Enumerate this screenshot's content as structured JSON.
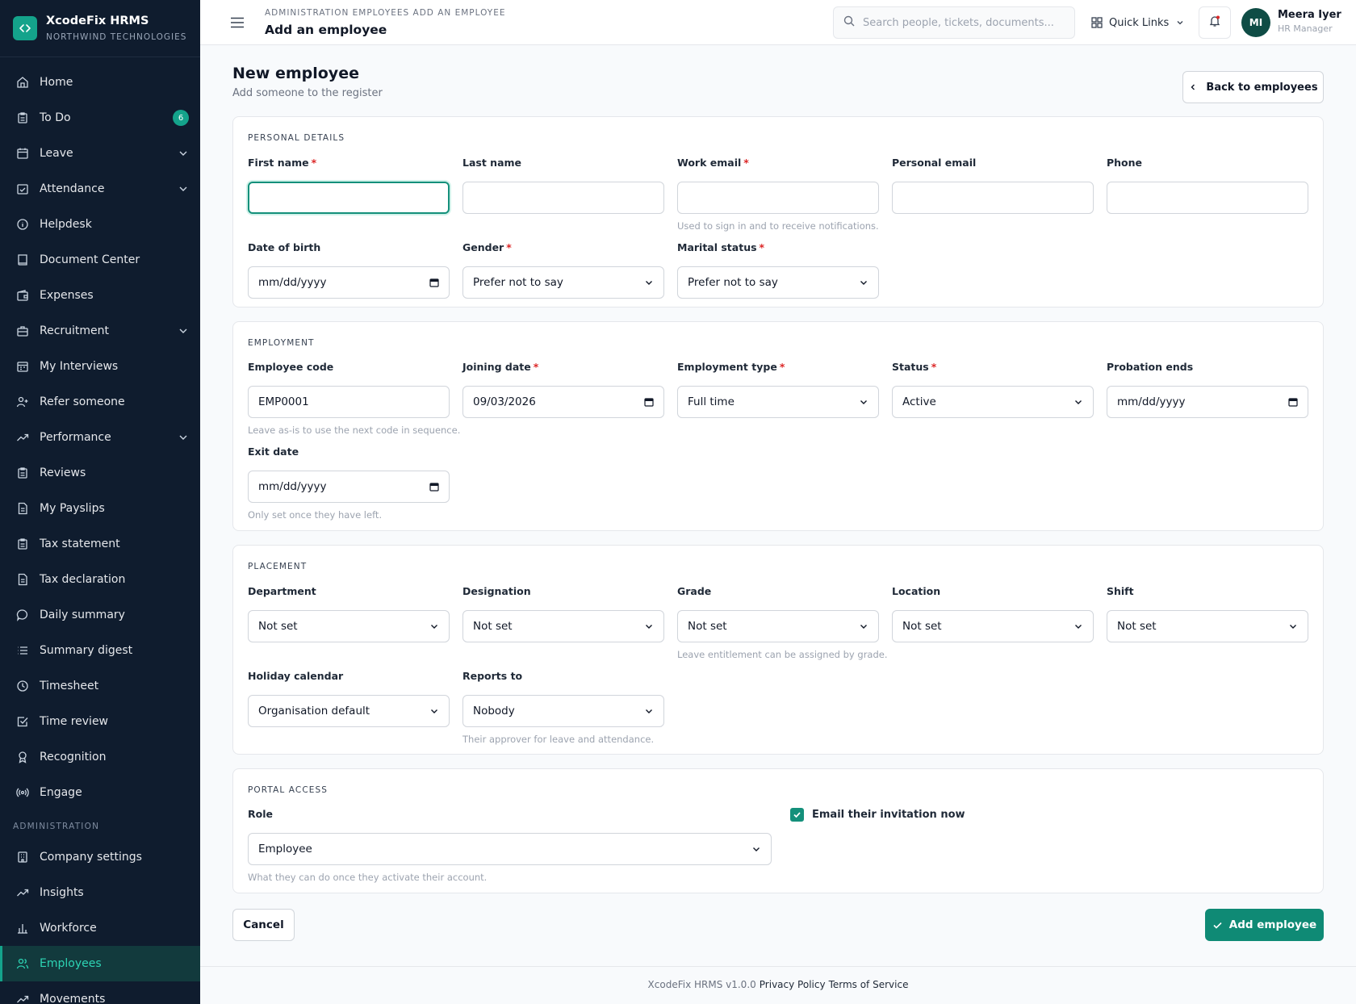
{
  "brand": {
    "title": "XcodeFix HRMS",
    "subtitle": "NORTHWIND TECHNOLOGIES"
  },
  "sidebar": {
    "items": [
      {
        "label": "Home",
        "icon": "home-icon"
      },
      {
        "label": "To Do",
        "icon": "clipboard-icon",
        "badge": "6"
      },
      {
        "label": "Leave",
        "icon": "calendar-icon",
        "chevron": true
      },
      {
        "label": "Attendance",
        "icon": "calendar-check-icon",
        "chevron": true
      },
      {
        "label": "Helpdesk",
        "icon": "info-circle-icon"
      },
      {
        "label": "Document Center",
        "icon": "book-icon"
      },
      {
        "label": "Expenses",
        "icon": "wallet-icon"
      },
      {
        "label": "Recruitment",
        "icon": "briefcase-icon",
        "chevron": true
      },
      {
        "label": "My Interviews",
        "icon": "calendar-icon"
      },
      {
        "label": "Refer someone",
        "icon": "user-plus-icon"
      },
      {
        "label": "Performance",
        "icon": "trending-up-icon",
        "chevron": true
      },
      {
        "label": "Reviews",
        "icon": "clipboard-icon"
      },
      {
        "label": "My Payslips",
        "icon": "file-icon"
      },
      {
        "label": "Tax statement",
        "icon": "clipboard-icon"
      },
      {
        "label": "Tax declaration",
        "icon": "file-icon"
      },
      {
        "label": "Daily summary",
        "icon": "message-icon"
      },
      {
        "label": "Summary digest",
        "icon": "list-icon"
      },
      {
        "label": "Timesheet",
        "icon": "clock-icon"
      },
      {
        "label": "Time review",
        "icon": "check-square-icon"
      },
      {
        "label": "Recognition",
        "icon": "award-icon"
      },
      {
        "label": "Engage",
        "icon": "broadcast-icon"
      }
    ],
    "section_admin": "ADMINISTRATION",
    "admin_items": [
      {
        "label": "Company settings",
        "icon": "building-icon"
      },
      {
        "label": "Insights",
        "icon": "trending-up-icon"
      },
      {
        "label": "Workforce",
        "icon": "bar-chart-icon"
      },
      {
        "label": "Employees",
        "icon": "users-icon",
        "active": true
      },
      {
        "label": "Movements",
        "icon": "trending-up-icon"
      }
    ]
  },
  "header": {
    "breadcrumb": "ADMINISTRATION  EMPLOYEES  ADD AN EMPLOYEE",
    "title": "Add an employee",
    "search_placeholder": "Search people, tickets, documents...",
    "quick_links": "Quick Links",
    "user": {
      "initials": "MI",
      "name": "Meera Iyer",
      "role": "HR Manager"
    }
  },
  "page": {
    "title": "New employee",
    "subtitle": "Add someone to the register",
    "back_label": "Back to employees"
  },
  "personal": {
    "section": "PERSONAL DETAILS",
    "first_name": {
      "label": "First name",
      "value": ""
    },
    "last_name": {
      "label": "Last name",
      "value": ""
    },
    "work_email": {
      "label": "Work email",
      "value": "",
      "hint": "Used to sign in and to receive notifications."
    },
    "personal_email": {
      "label": "Personal email",
      "value": ""
    },
    "phone": {
      "label": "Phone",
      "value": ""
    },
    "dob": {
      "label": "Date of birth",
      "value": "mm/dd/yyyy"
    },
    "gender": {
      "label": "Gender",
      "value": "Prefer not to say"
    },
    "marital": {
      "label": "Marital status",
      "value": "Prefer not to say"
    }
  },
  "employment": {
    "section": "EMPLOYMENT",
    "code": {
      "label": "Employee code",
      "value": "EMP0001",
      "hint": "Leave as-is to use the next code in sequence."
    },
    "joining": {
      "label": "Joining date",
      "value": "09/03/2026"
    },
    "type": {
      "label": "Employment type",
      "value": "Full time"
    },
    "status": {
      "label": "Status",
      "value": "Active"
    },
    "probation": {
      "label": "Probation ends",
      "value": "mm/dd/yyyy"
    },
    "exit": {
      "label": "Exit date",
      "value": "mm/dd/yyyy",
      "hint": "Only set once they have left."
    }
  },
  "placement": {
    "section": "PLACEMENT",
    "department": {
      "label": "Department",
      "value": "Not set"
    },
    "designation": {
      "label": "Designation",
      "value": "Not set"
    },
    "grade": {
      "label": "Grade",
      "value": "Not set",
      "hint": "Leave entitlement can be assigned by grade."
    },
    "location": {
      "label": "Location",
      "value": "Not set"
    },
    "shift": {
      "label": "Shift",
      "value": "Not set"
    },
    "holiday": {
      "label": "Holiday calendar",
      "value": "Organisation default"
    },
    "reports_to": {
      "label": "Reports to",
      "value": "Nobody",
      "hint": "Their approver for leave and attendance."
    }
  },
  "portal": {
    "section": "PORTAL ACCESS",
    "role": {
      "label": "Role",
      "value": "Employee",
      "hint": "What they can do once they activate their account."
    },
    "invite_label": "Email their invitation now",
    "invite_checked": true
  },
  "actions": {
    "cancel": "Cancel",
    "add": "Add employee"
  },
  "footer": {
    "version": "XcodeFix HRMS v1.0.0",
    "privacy": "Privacy Policy",
    "terms": "Terms of Service"
  },
  "colors": {
    "sidebar_bg": "#0f1c2e",
    "accent": "#14907b",
    "required": "#dc2626"
  }
}
